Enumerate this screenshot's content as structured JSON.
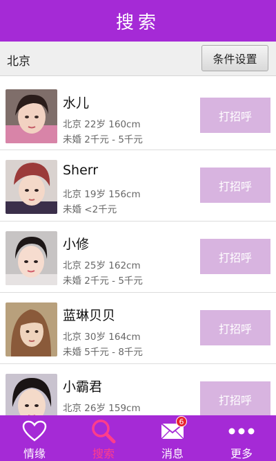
{
  "header": {
    "title": "搜索"
  },
  "filter": {
    "city": "北京",
    "conditions_button": "条件设置"
  },
  "users": [
    {
      "name": "水儿",
      "info1": "北京 22岁 160cm",
      "info2": "未婚 2千元 - 5千元",
      "button": "打招呼"
    },
    {
      "name": "Sherr",
      "info1": "北京 19岁 156cm",
      "info2": "未婚 <2千元",
      "button": "打招呼"
    },
    {
      "name": "小修",
      "info1": "北京 25岁 162cm",
      "info2": "未婚 2千元 - 5千元",
      "button": "打招呼"
    },
    {
      "name": "蓝琳贝贝",
      "info1": "北京 30岁 164cm",
      "info2": "未婚 5千元 - 8千元",
      "button": "打招呼"
    },
    {
      "name": "小霸君",
      "info1": "北京 26岁 159cm",
      "info2": "",
      "button": "打招呼"
    }
  ],
  "tabs": [
    {
      "label": "情缘",
      "icon": "heart-icon"
    },
    {
      "label": "搜索",
      "icon": "search-icon"
    },
    {
      "label": "消息",
      "icon": "mail-icon",
      "badge": "6"
    },
    {
      "label": "更多",
      "icon": "more-dots-icon"
    }
  ],
  "colors": {
    "brand": "#a52ad6",
    "active_tab": "#ff3d8b",
    "greet_button": "#d8b4e0",
    "badge": "#e8232e"
  }
}
